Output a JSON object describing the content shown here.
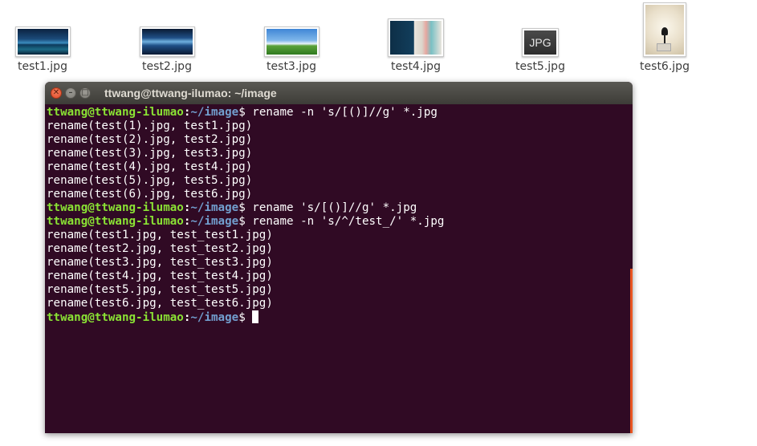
{
  "desktop": {
    "files": [
      {
        "name": "test1.jpg",
        "thumb": "blue-night-mountain-lake"
      },
      {
        "name": "test2.jpg",
        "thumb": "blue-mountain-reflection"
      },
      {
        "name": "test3.jpg",
        "thumb": "green-field-blue-sky"
      },
      {
        "name": "test4.jpg",
        "thumb": "dark-blue-poster-with-figures"
      },
      {
        "name": "test5.jpg",
        "thumb_text": "JPG"
      },
      {
        "name": "test6.jpg",
        "thumb": "lamp-still-life"
      }
    ]
  },
  "terminal": {
    "title": "ttwang@ttwang-ilumao: ~/image",
    "prompt": {
      "user_host": "ttwang@ttwang-ilumao",
      "colon": ":",
      "path": "~/image",
      "symbol": "$ "
    },
    "lines": [
      {
        "type": "cmd",
        "text": "rename -n 's/[()]//g' *.jpg"
      },
      {
        "type": "out",
        "text": "rename(test(1).jpg, test1.jpg)"
      },
      {
        "type": "out",
        "text": "rename(test(2).jpg, test2.jpg)"
      },
      {
        "type": "out",
        "text": "rename(test(3).jpg, test3.jpg)"
      },
      {
        "type": "out",
        "text": "rename(test(4).jpg, test4.jpg)"
      },
      {
        "type": "out",
        "text": "rename(test(5).jpg, test5.jpg)"
      },
      {
        "type": "out",
        "text": "rename(test(6).jpg, test6.jpg)"
      },
      {
        "type": "cmd",
        "text": "rename 's/[()]//g' *.jpg"
      },
      {
        "type": "cmd",
        "text": "rename -n 's/^/test_/' *.jpg"
      },
      {
        "type": "out",
        "text": "rename(test1.jpg, test_test1.jpg)"
      },
      {
        "type": "out",
        "text": "rename(test2.jpg, test_test2.jpg)"
      },
      {
        "type": "out",
        "text": "rename(test3.jpg, test_test3.jpg)"
      },
      {
        "type": "out",
        "text": "rename(test4.jpg, test_test4.jpg)"
      },
      {
        "type": "out",
        "text": "rename(test5.jpg, test_test5.jpg)"
      },
      {
        "type": "out",
        "text": "rename(test6.jpg, test_test6.jpg)"
      },
      {
        "type": "cmd",
        "text": "",
        "cursor": true
      }
    ],
    "colors": {
      "background": "#300a24",
      "prompt_user": "#8ae234",
      "prompt_path": "#729fcf",
      "text": "#ffffff",
      "accent": "#e95420"
    }
  }
}
